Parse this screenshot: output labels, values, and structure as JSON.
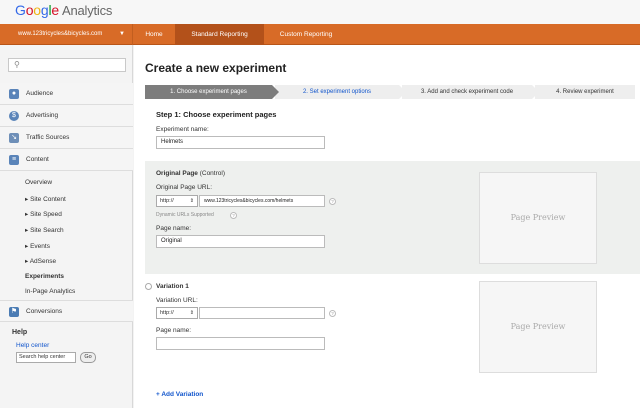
{
  "app": {
    "logo_google": [
      "G",
      "o",
      "o",
      "g",
      "l",
      "e"
    ],
    "logo_analytics": "Analytics"
  },
  "navbar": {
    "account": "www.123tricycles&bicycles.com",
    "tabs": [
      {
        "label": "Home"
      },
      {
        "label": "Standard Reporting"
      },
      {
        "label": "Custom Reporting"
      }
    ]
  },
  "sidebar": {
    "search_placeholder": "",
    "sections": [
      {
        "label": "Audience",
        "icon": "people-icon"
      },
      {
        "label": "Advertising",
        "icon": "dollar-icon"
      },
      {
        "label": "Traffic Sources",
        "icon": "arrows-icon"
      },
      {
        "label": "Content",
        "icon": "document-icon"
      }
    ],
    "content_items": [
      {
        "label": "Overview"
      },
      {
        "label": "▸ Site Content"
      },
      {
        "label": "▸ Site Speed"
      },
      {
        "label": "▸ Site Search"
      },
      {
        "label": "▸ Events"
      },
      {
        "label": "▸ AdSense"
      },
      {
        "label": "Experiments"
      },
      {
        "label": "In-Page Analytics"
      }
    ],
    "conversions": "Conversions",
    "help": {
      "heading": "Help",
      "link": "Help center",
      "search_value": "Search help center",
      "go": "Go"
    }
  },
  "main": {
    "title": "Create a new experiment",
    "steps": [
      {
        "label": "1. Choose experiment pages"
      },
      {
        "label": "2. Set experiment options"
      },
      {
        "label": "3. Add and check experiment code"
      },
      {
        "label": "4. Review experiment"
      }
    ],
    "step_heading": "Step 1: Choose experiment pages",
    "experiment_name_label": "Experiment name:",
    "experiment_name_value": "Helmets",
    "original": {
      "heading_bold": "Original Page",
      "heading_rest": " (Control)",
      "url_label": "Original Page URL:",
      "protocol": "http://",
      "url_value": "www.123tricycles&bicycles.com/helmets",
      "dynamic_note": "Dynamic URLs Supported",
      "page_name_label": "Page name:",
      "page_name_value": "Original",
      "preview": "Page Preview"
    },
    "variation": {
      "heading": "Variation 1",
      "url_label": "Variation URL:",
      "protocol": "http://",
      "url_value": "",
      "page_name_label": "Page name:",
      "page_name_value": "",
      "preview": "Page Preview"
    },
    "add_variation": "+ Add Variation"
  },
  "colors": {
    "nav_orange": "#d86b27",
    "link_blue": "#1155cc",
    "active_step": "#7d7d7d"
  }
}
